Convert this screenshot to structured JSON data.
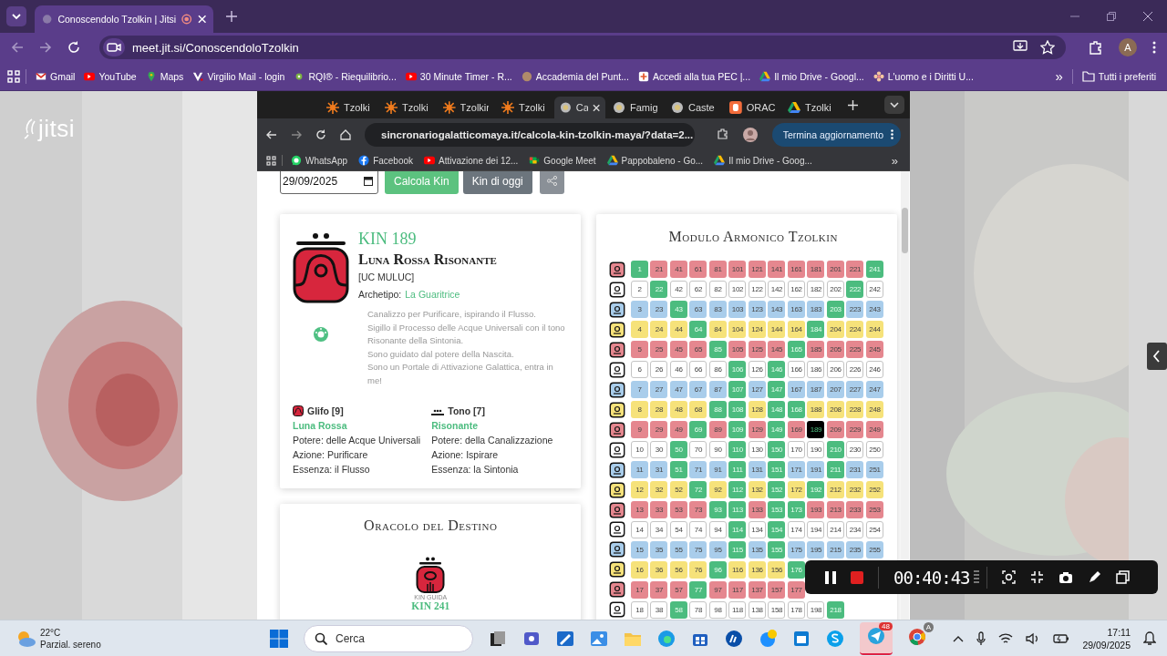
{
  "browser": {
    "tab": {
      "title": "Conoscendolo Tzolkin | Jitsi",
      "selected": true
    },
    "url": "meet.jit.si/ConoscendoloTzolkin",
    "avatar": "A",
    "bookmarks": [
      "Gmail",
      "YouTube",
      "Maps",
      "Virgilio Mail - login",
      "RQI® - Riequilibrio...",
      "30 Minute Timer - R...",
      "Accademia del Punt...",
      "Accedi alla tua PEC |...",
      "Il mio Drive - Googl...",
      "L'uomo e i Diritti U..."
    ],
    "more": "»",
    "all_bookmarks": "Tutti i preferiti"
  },
  "meeting": {
    "logo": "jitsi"
  },
  "shared_screen": {
    "tabs": [
      {
        "label": "Tzolki",
        "selected": false
      },
      {
        "label": "Tzolki",
        "selected": false
      },
      {
        "label": "Tzolkir",
        "selected": false
      },
      {
        "label": "Tzolki",
        "selected": false
      },
      {
        "label": "Ca",
        "selected": true
      },
      {
        "label": "Famig",
        "selected": false
      },
      {
        "label": "Caste",
        "selected": false
      },
      {
        "label": "ORAC",
        "selected": false
      },
      {
        "label": "Tzolki",
        "selected": false
      }
    ],
    "url": "sincronariogalatticomaya.it/calcola-kin-tzolkin-maya/?data=2...",
    "update_button": "Termina aggiornamento",
    "bookmarks": [
      "WhatsApp",
      "Facebook",
      "Attivazione dei 12...",
      "Google Meet",
      "Pappobaleno - Go...",
      "Il mio Drive - Goog..."
    ],
    "more": "»",
    "form": {
      "date": "29/09/2025",
      "buttons": [
        {
          "label": "Calcola Kin",
          "kind": "primary"
        },
        {
          "label": "Kin di oggi",
          "kind": "secondary"
        }
      ]
    },
    "kin_card": {
      "kin": "KIN 189",
      "name": "Luna Rossa Risonante",
      "maya_name": "[UC MULUC]",
      "archetype_label": "Archetipo:",
      "archetype": "La Guaritrice",
      "affirmation": [
        "Canalizzo per Purificare, ispirando il Flusso.",
        "Sigillo il Processo delle Acque Universali con il tono Risonante della Sintonia.",
        "Sono guidato dal potere della Nascita.",
        "Sono un Portale di Attivazione Galattica, entra in me!"
      ],
      "details": [
        {
          "kind": "glyph",
          "heading": "Glifo [9]",
          "name": "Luna Rossa",
          "lines": [
            "Potere: delle Acque Universali",
            "Azione: Purificare",
            "Essenza: il Flusso"
          ]
        },
        {
          "kind": "tone",
          "heading": "Tono [7]",
          "name": "Risonante",
          "lines": [
            "Potere: della Canalizzazione",
            "Azione: Ispirare",
            "Essenza: la Sintonia"
          ]
        }
      ]
    },
    "oracle": {
      "title": "Oracolo del Destino",
      "caption": "KIN GUIDA",
      "kin": "KIN 241"
    },
    "module": {
      "title": "Modulo Armonico Tzolkin",
      "rows": [
        {
          "color": "#e5878f",
          "cells": [
            {
              "value": "1",
              "portal": true,
              "selected": false
            },
            {
              "value": "21",
              "portal": false,
              "selected": false
            },
            {
              "value": "41",
              "portal": false,
              "selected": false
            },
            {
              "value": "61",
              "portal": false,
              "selected": false
            },
            {
              "value": "81",
              "portal": false,
              "selected": false
            },
            {
              "value": "101",
              "portal": false,
              "selected": false
            },
            {
              "value": "121",
              "portal": false,
              "selected": false
            },
            {
              "value": "141",
              "portal": false,
              "selected": false
            },
            {
              "value": "161",
              "portal": false,
              "selected": false
            },
            {
              "value": "181",
              "portal": false,
              "selected": false
            },
            {
              "value": "201",
              "portal": false,
              "selected": false
            },
            {
              "value": "221",
              "portal": false,
              "selected": false
            },
            {
              "value": "241",
              "portal": true,
              "selected": false
            }
          ]
        },
        {
          "color": "#ffffff",
          "cells": [
            {
              "value": "2",
              "portal": false,
              "selected": false
            },
            {
              "value": "22",
              "portal": true,
              "selected": false
            },
            {
              "value": "42",
              "portal": false,
              "selected": false
            },
            {
              "value": "62",
              "portal": false,
              "selected": false
            },
            {
              "value": "82",
              "portal": false,
              "selected": false
            },
            {
              "value": "102",
              "portal": false,
              "selected": false
            },
            {
              "value": "122",
              "portal": false,
              "selected": false
            },
            {
              "value": "142",
              "portal": false,
              "selected": false
            },
            {
              "value": "162",
              "portal": false,
              "selected": false
            },
            {
              "value": "182",
              "portal": false,
              "selected": false
            },
            {
              "value": "202",
              "portal": false,
              "selected": false
            },
            {
              "value": "222",
              "portal": true,
              "selected": false
            },
            {
              "value": "242",
              "portal": false,
              "selected": false
            }
          ]
        },
        {
          "color": "#a9cdeb",
          "cells": [
            {
              "value": "3",
              "portal": false,
              "selected": false
            },
            {
              "value": "23",
              "portal": false,
              "selected": false
            },
            {
              "value": "43",
              "portal": true,
              "selected": false
            },
            {
              "value": "63",
              "portal": false,
              "selected": false
            },
            {
              "value": "83",
              "portal": false,
              "selected": false
            },
            {
              "value": "103",
              "portal": false,
              "selected": false
            },
            {
              "value": "123",
              "portal": false,
              "selected": false
            },
            {
              "value": "143",
              "portal": false,
              "selected": false
            },
            {
              "value": "163",
              "portal": false,
              "selected": false
            },
            {
              "value": "183",
              "portal": false,
              "selected": false
            },
            {
              "value": "203",
              "portal": true,
              "selected": false
            },
            {
              "value": "223",
              "portal": false,
              "selected": false
            },
            {
              "value": "243",
              "portal": false,
              "selected": false
            }
          ]
        },
        {
          "color": "#f6e27a",
          "cells": [
            {
              "value": "4",
              "portal": false,
              "selected": false
            },
            {
              "value": "24",
              "portal": false,
              "selected": false
            },
            {
              "value": "44",
              "portal": false,
              "selected": false
            },
            {
              "value": "64",
              "portal": true,
              "selected": false
            },
            {
              "value": "84",
              "portal": false,
              "selected": false
            },
            {
              "value": "104",
              "portal": false,
              "selected": false
            },
            {
              "value": "124",
              "portal": false,
              "selected": false
            },
            {
              "value": "144",
              "portal": false,
              "selected": false
            },
            {
              "value": "164",
              "portal": false,
              "selected": false
            },
            {
              "value": "184",
              "portal": true,
              "selected": false
            },
            {
              "value": "204",
              "portal": false,
              "selected": false
            },
            {
              "value": "224",
              "portal": false,
              "selected": false
            },
            {
              "value": "244",
              "portal": false,
              "selected": false
            }
          ]
        },
        {
          "color": "#e5878f",
          "cells": [
            {
              "value": "5",
              "portal": false,
              "selected": false
            },
            {
              "value": "25",
              "portal": false,
              "selected": false
            },
            {
              "value": "45",
              "portal": false,
              "selected": false
            },
            {
              "value": "65",
              "portal": false,
              "selected": false
            },
            {
              "value": "85",
              "portal": true,
              "selected": false
            },
            {
              "value": "105",
              "portal": false,
              "selected": false
            },
            {
              "value": "125",
              "portal": false,
              "selected": false
            },
            {
              "value": "145",
              "portal": false,
              "selected": false
            },
            {
              "value": "165",
              "portal": true,
              "selected": false
            },
            {
              "value": "185",
              "portal": false,
              "selected": false
            },
            {
              "value": "205",
              "portal": false,
              "selected": false
            },
            {
              "value": "225",
              "portal": false,
              "selected": false
            },
            {
              "value": "245",
              "portal": false,
              "selected": false
            }
          ]
        },
        {
          "color": "#ffffff",
          "cells": [
            {
              "value": "6",
              "portal": false,
              "selected": false
            },
            {
              "value": "26",
              "portal": false,
              "selected": false
            },
            {
              "value": "46",
              "portal": false,
              "selected": false
            },
            {
              "value": "66",
              "portal": false,
              "selected": false
            },
            {
              "value": "86",
              "portal": false,
              "selected": false
            },
            {
              "value": "106",
              "portal": true,
              "selected": false
            },
            {
              "value": "126",
              "portal": false,
              "selected": false
            },
            {
              "value": "146",
              "portal": true,
              "selected": false
            },
            {
              "value": "166",
              "portal": false,
              "selected": false
            },
            {
              "value": "186",
              "portal": false,
              "selected": false
            },
            {
              "value": "206",
              "portal": false,
              "selected": false
            },
            {
              "value": "226",
              "portal": false,
              "selected": false
            },
            {
              "value": "246",
              "portal": false,
              "selected": false
            }
          ]
        },
        {
          "color": "#a9cdeb",
          "cells": [
            {
              "value": "7",
              "portal": false,
              "selected": false
            },
            {
              "value": "27",
              "portal": false,
              "selected": false
            },
            {
              "value": "47",
              "portal": false,
              "selected": false
            },
            {
              "value": "67",
              "portal": false,
              "selected": false
            },
            {
              "value": "87",
              "portal": false,
              "selected": false
            },
            {
              "value": "107",
              "portal": true,
              "selected": false
            },
            {
              "value": "127",
              "portal": false,
              "selected": false
            },
            {
              "value": "147",
              "portal": true,
              "selected": false
            },
            {
              "value": "167",
              "portal": false,
              "selected": false
            },
            {
              "value": "187",
              "portal": false,
              "selected": false
            },
            {
              "value": "207",
              "portal": false,
              "selected": false
            },
            {
              "value": "227",
              "portal": false,
              "selected": false
            },
            {
              "value": "247",
              "portal": false,
              "selected": false
            }
          ]
        },
        {
          "color": "#f6e27a",
          "cells": [
            {
              "value": "8",
              "portal": false,
              "selected": false
            },
            {
              "value": "28",
              "portal": false,
              "selected": false
            },
            {
              "value": "48",
              "portal": false,
              "selected": false
            },
            {
              "value": "68",
              "portal": false,
              "selected": false
            },
            {
              "value": "88",
              "portal": true,
              "selected": false
            },
            {
              "value": "108",
              "portal": true,
              "selected": false
            },
            {
              "value": "128",
              "portal": false,
              "selected": false
            },
            {
              "value": "148",
              "portal": true,
              "selected": false
            },
            {
              "value": "168",
              "portal": true,
              "selected": false
            },
            {
              "value": "188",
              "portal": false,
              "selected": false
            },
            {
              "value": "208",
              "portal": false,
              "selected": false
            },
            {
              "value": "228",
              "portal": false,
              "selected": false
            },
            {
              "value": "248",
              "portal": false,
              "selected": false
            }
          ]
        },
        {
          "color": "#e5878f",
          "cells": [
            {
              "value": "9",
              "portal": false,
              "selected": false
            },
            {
              "value": "29",
              "portal": false,
              "selected": false
            },
            {
              "value": "49",
              "portal": false,
              "selected": false
            },
            {
              "value": "69",
              "portal": true,
              "selected": false
            },
            {
              "value": "89",
              "portal": false,
              "selected": false
            },
            {
              "value": "109",
              "portal": true,
              "selected": false
            },
            {
              "value": "129",
              "portal": false,
              "selected": false
            },
            {
              "value": "149",
              "portal": true,
              "selected": false
            },
            {
              "value": "169",
              "portal": false,
              "selected": false
            },
            {
              "value": "189",
              "portal": true,
              "selected": true
            },
            {
              "value": "209",
              "portal": false,
              "selected": false
            },
            {
              "value": "229",
              "portal": false,
              "selected": false
            },
            {
              "value": "249",
              "portal": false,
              "selected": false
            }
          ]
        },
        {
          "color": "#ffffff",
          "cells": [
            {
              "value": "10",
              "portal": false,
              "selected": false
            },
            {
              "value": "30",
              "portal": false,
              "selected": false
            },
            {
              "value": "50",
              "portal": true,
              "selected": false
            },
            {
              "value": "70",
              "portal": false,
              "selected": false
            },
            {
              "value": "90",
              "portal": false,
              "selected": false
            },
            {
              "value": "110",
              "portal": true,
              "selected": false
            },
            {
              "value": "130",
              "portal": false,
              "selected": false
            },
            {
              "value": "150",
              "portal": true,
              "selected": false
            },
            {
              "value": "170",
              "portal": false,
              "selected": false
            },
            {
              "value": "190",
              "portal": false,
              "selected": false
            },
            {
              "value": "210",
              "portal": true,
              "selected": false
            },
            {
              "value": "230",
              "portal": false,
              "selected": false
            },
            {
              "value": "250",
              "portal": false,
              "selected": false
            }
          ]
        },
        {
          "color": "#a9cdeb",
          "cells": [
            {
              "value": "11",
              "portal": false,
              "selected": false
            },
            {
              "value": "31",
              "portal": false,
              "selected": false
            },
            {
              "value": "51",
              "portal": true,
              "selected": false
            },
            {
              "value": "71",
              "portal": false,
              "selected": false
            },
            {
              "value": "91",
              "portal": false,
              "selected": false
            },
            {
              "value": "111",
              "portal": true,
              "selected": false
            },
            {
              "value": "131",
              "portal": false,
              "selected": false
            },
            {
              "value": "151",
              "portal": true,
              "selected": false
            },
            {
              "value": "171",
              "portal": false,
              "selected": false
            },
            {
              "value": "191",
              "portal": false,
              "selected": false
            },
            {
              "value": "211",
              "portal": true,
              "selected": false
            },
            {
              "value": "231",
              "portal": false,
              "selected": false
            },
            {
              "value": "251",
              "portal": false,
              "selected": false
            }
          ]
        },
        {
          "color": "#f6e27a",
          "cells": [
            {
              "value": "12",
              "portal": false,
              "selected": false
            },
            {
              "value": "32",
              "portal": false,
              "selected": false
            },
            {
              "value": "52",
              "portal": false,
              "selected": false
            },
            {
              "value": "72",
              "portal": true,
              "selected": false
            },
            {
              "value": "92",
              "portal": false,
              "selected": false
            },
            {
              "value": "112",
              "portal": true,
              "selected": false
            },
            {
              "value": "132",
              "portal": false,
              "selected": false
            },
            {
              "value": "152",
              "portal": true,
              "selected": false
            },
            {
              "value": "172",
              "portal": false,
              "selected": false
            },
            {
              "value": "192",
              "portal": true,
              "selected": false
            },
            {
              "value": "212",
              "portal": false,
              "selected": false
            },
            {
              "value": "232",
              "portal": false,
              "selected": false
            },
            {
              "value": "252",
              "portal": false,
              "selected": false
            }
          ]
        },
        {
          "color": "#e5878f",
          "cells": [
            {
              "value": "13",
              "portal": false,
              "selected": false
            },
            {
              "value": "33",
              "portal": false,
              "selected": false
            },
            {
              "value": "53",
              "portal": false,
              "selected": false
            },
            {
              "value": "73",
              "portal": false,
              "selected": false
            },
            {
              "value": "93",
              "portal": true,
              "selected": false
            },
            {
              "value": "113",
              "portal": true,
              "selected": false
            },
            {
              "value": "133",
              "portal": false,
              "selected": false
            },
            {
              "value": "153",
              "portal": true,
              "selected": false
            },
            {
              "value": "173",
              "portal": true,
              "selected": false
            },
            {
              "value": "193",
              "portal": false,
              "selected": false
            },
            {
              "value": "213",
              "portal": false,
              "selected": false
            },
            {
              "value": "233",
              "portal": false,
              "selected": false
            },
            {
              "value": "253",
              "portal": false,
              "selected": false
            }
          ]
        },
        {
          "color": "#ffffff",
          "cells": [
            {
              "value": "14",
              "portal": false,
              "selected": false
            },
            {
              "value": "34",
              "portal": false,
              "selected": false
            },
            {
              "value": "54",
              "portal": false,
              "selected": false
            },
            {
              "value": "74",
              "portal": false,
              "selected": false
            },
            {
              "value": "94",
              "portal": false,
              "selected": false
            },
            {
              "value": "114",
              "portal": true,
              "selected": false
            },
            {
              "value": "134",
              "portal": false,
              "selected": false
            },
            {
              "value": "154",
              "portal": true,
              "selected": false
            },
            {
              "value": "174",
              "portal": false,
              "selected": false
            },
            {
              "value": "194",
              "portal": false,
              "selected": false
            },
            {
              "value": "214",
              "portal": false,
              "selected": false
            },
            {
              "value": "234",
              "portal": false,
              "selected": false
            },
            {
              "value": "254",
              "portal": false,
              "selected": false
            }
          ]
        },
        {
          "color": "#a9cdeb",
          "cells": [
            {
              "value": "15",
              "portal": false,
              "selected": false
            },
            {
              "value": "35",
              "portal": false,
              "selected": false
            },
            {
              "value": "55",
              "portal": false,
              "selected": false
            },
            {
              "value": "75",
              "portal": false,
              "selected": false
            },
            {
              "value": "95",
              "portal": false,
              "selected": false
            },
            {
              "value": "115",
              "portal": true,
              "selected": false
            },
            {
              "value": "135",
              "portal": false,
              "selected": false
            },
            {
              "value": "155",
              "portal": true,
              "selected": false
            },
            {
              "value": "175",
              "portal": false,
              "selected": false
            },
            {
              "value": "195",
              "portal": false,
              "selected": false
            },
            {
              "value": "215",
              "portal": false,
              "selected": false
            },
            {
              "value": "235",
              "portal": false,
              "selected": false
            },
            {
              "value": "255",
              "portal": false,
              "selected": false
            }
          ]
        },
        {
          "color": "#f6e27a",
          "cells": [
            {
              "value": "16",
              "portal": false,
              "selected": false
            },
            {
              "value": "36",
              "portal": false,
              "selected": false
            },
            {
              "value": "56",
              "portal": false,
              "selected": false
            },
            {
              "value": "76",
              "portal": false,
              "selected": false
            },
            {
              "value": "96",
              "portal": true,
              "selected": false
            },
            {
              "value": "116",
              "portal": false,
              "selected": false
            },
            {
              "value": "136",
              "portal": false,
              "selected": false
            },
            {
              "value": "156",
              "portal": false,
              "selected": false
            },
            {
              "value": "176",
              "portal": true,
              "selected": false
            }
          ]
        },
        {
          "color": "#e5878f",
          "cells": [
            {
              "value": "17",
              "portal": false,
              "selected": false
            },
            {
              "value": "37",
              "portal": false,
              "selected": false
            },
            {
              "value": "57",
              "portal": false,
              "selected": false
            },
            {
              "value": "77",
              "portal": true,
              "selected": false
            },
            {
              "value": "97",
              "portal": false,
              "selected": false
            },
            {
              "value": "117",
              "portal": false,
              "selected": false
            },
            {
              "value": "137",
              "portal": false,
              "selected": false
            },
            {
              "value": "157",
              "portal": false,
              "selected": false
            },
            {
              "value": "177",
              "portal": false,
              "selected": false
            }
          ]
        },
        {
          "color": "#ffffff",
          "cells": [
            {
              "value": "18",
              "portal": false,
              "selected": false
            },
            {
              "value": "38",
              "portal": false,
              "selected": false
            },
            {
              "value": "58",
              "portal": true,
              "selected": false
            },
            {
              "value": "78",
              "portal": false,
              "selected": false
            },
            {
              "value": "98",
              "portal": false,
              "selected": false
            },
            {
              "value": "118",
              "portal": false,
              "selected": false
            },
            {
              "value": "138",
              "portal": false,
              "selected": false
            },
            {
              "value": "158",
              "portal": false,
              "selected": false
            },
            {
              "value": "178",
              "portal": false,
              "selected": false
            },
            {
              "value": "198",
              "portal": false,
              "selected": false
            },
            {
              "value": "218",
              "portal": true,
              "selected": false
            }
          ]
        }
      ]
    }
  },
  "recorder": {
    "time": "00:40:43"
  },
  "taskbar": {
    "temperature": "22°C",
    "weather": "Parzial. sereno",
    "search": {
      "placeholder": "Cerca"
    },
    "badge": "48",
    "avatar": "A",
    "time": "17:11",
    "date": "29/09/2025"
  }
}
